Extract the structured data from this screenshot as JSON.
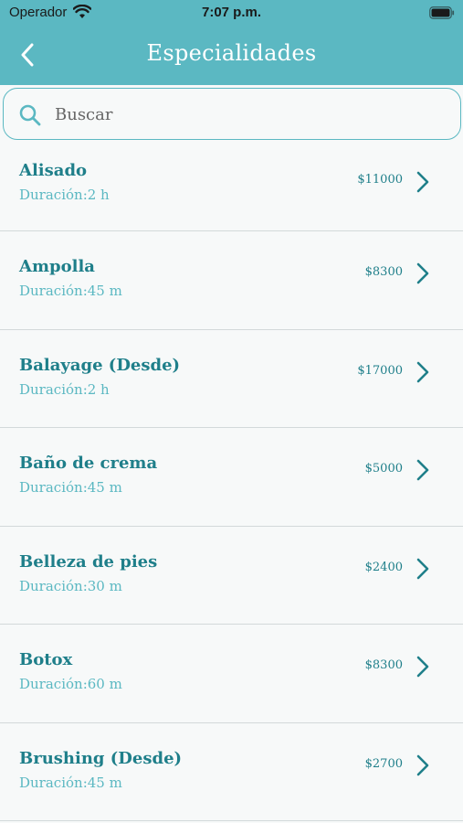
{
  "status_bar": {
    "carrier": "Operador",
    "time": "7:07 p.m."
  },
  "header": {
    "title": "Especialidades",
    "back_icon": "chevron-left-icon"
  },
  "search": {
    "placeholder": "Buscar",
    "value": ""
  },
  "colors": {
    "accent": "#5bb8c2",
    "text_primary": "#1f7f8a",
    "background": "#f7f9f9"
  },
  "services": [
    {
      "name": "Alisado",
      "duration": "Duración:2 h",
      "price": "$11000"
    },
    {
      "name": "Ampolla",
      "duration": "Duración:45 m",
      "price": "$8300"
    },
    {
      "name": "Balayage (Desde)",
      "duration": "Duración:2 h",
      "price": "$17000"
    },
    {
      "name": "Baño de crema",
      "duration": "Duración:45 m",
      "price": "$5000"
    },
    {
      "name": "Belleza de pies",
      "duration": "Duración:30 m",
      "price": "$2400"
    },
    {
      "name": "Botox",
      "duration": "Duración:60 m",
      "price": "$8300"
    },
    {
      "name": "Brushing (Desde)",
      "duration": "Duración:45 m",
      "price": "$2700"
    }
  ]
}
